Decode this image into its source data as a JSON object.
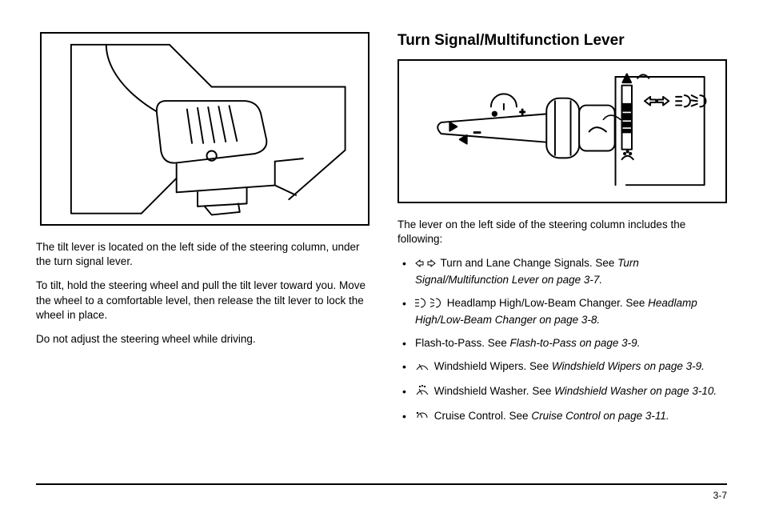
{
  "left": {
    "p1": "The tilt lever is located on the left side of the steering column, under the turn signal lever.",
    "p2": "To tilt, hold the steering wheel and pull the tilt lever toward you. Move the wheel to a comfortable level, then release the tilt lever to lock the wheel in place.",
    "p3": "Do not adjust the steering wheel while driving."
  },
  "right": {
    "heading": "Turn Signal/Multifunction Lever",
    "intro": "The lever on the left side of the steering column includes the following:",
    "items": [
      {
        "text": "Turn and Lane Change Signals. See ",
        "ref": "Turn Signal/Multifunction Lever on page 3-7."
      },
      {
        "text": "Headlamp High/Low-Beam Changer. See ",
        "ref": "Headlamp High/Low-Beam Changer on page 3-8."
      },
      {
        "text": "Flash-to-Pass. See ",
        "ref": "Flash-to-Pass on page 3-9."
      },
      {
        "text": "Windshield Wipers. See ",
        "ref": "Windshield Wipers on page 3-9."
      },
      {
        "text": "Windshield Washer. See ",
        "ref": "Windshield Washer on page 3-10."
      },
      {
        "text": "Cruise Control. See ",
        "ref": "Cruise Control on page 3-11."
      }
    ]
  },
  "page_number": "3-7"
}
